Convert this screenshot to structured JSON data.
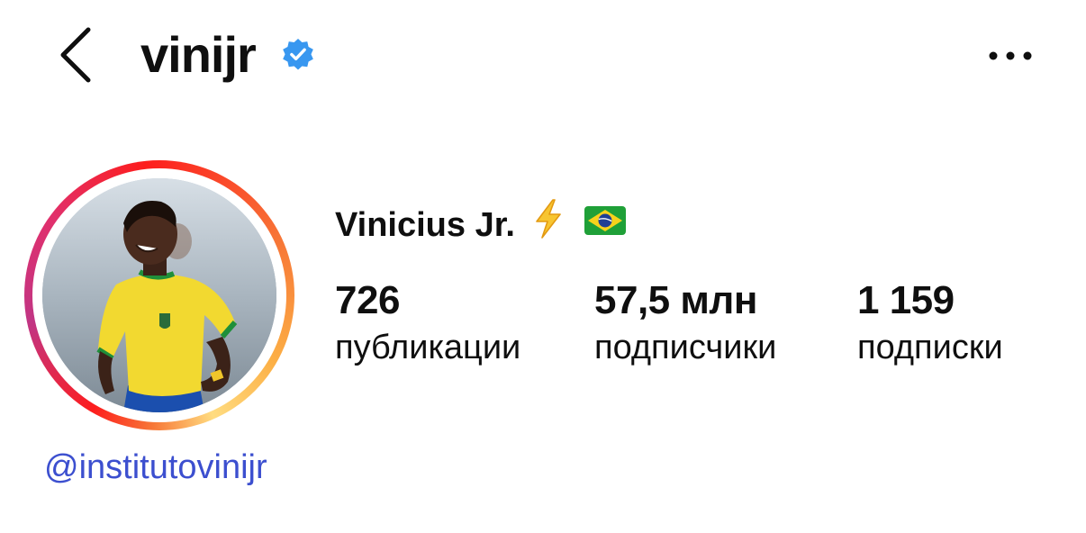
{
  "header": {
    "username": "vinijr",
    "verified": true,
    "back_icon": "chevron-left-icon",
    "more_icon": "more-horizontal-icon"
  },
  "profile": {
    "display_name": "Vinicius Jr.",
    "name_emojis": [
      "lightning-icon",
      "brazil-flag-icon"
    ],
    "link_handle": "@institutovinijr",
    "stats": {
      "posts": {
        "value": "726",
        "label": "публикации"
      },
      "followers": {
        "value": "57,5 млн",
        "label": "подписчики"
      },
      "following": {
        "value": "1 159",
        "label": "подписки"
      }
    }
  },
  "colors": {
    "text": "#0f0f0f",
    "verified_blue": "#3897f0",
    "link": "#3c4fcf",
    "story_ring": [
      "#fd1d1d",
      "#c13584",
      "#f77737",
      "#fcaf45"
    ]
  }
}
